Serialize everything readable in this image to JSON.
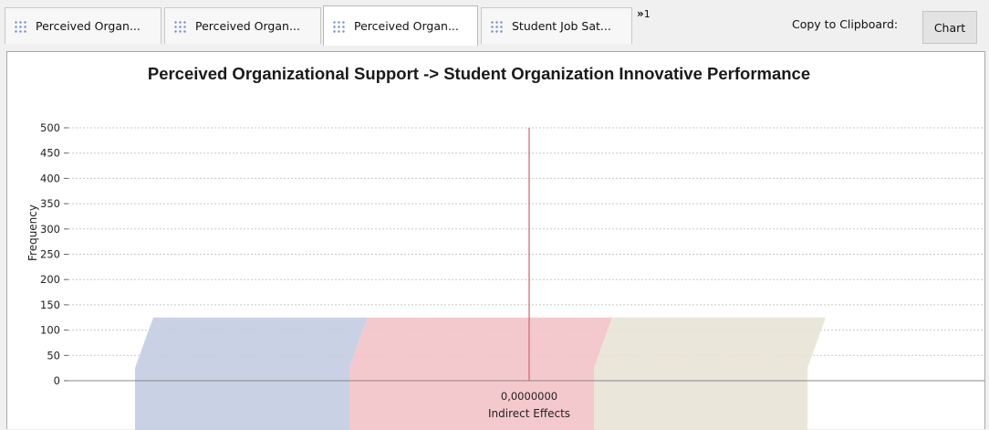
{
  "tabs": [
    {
      "label": "Perceived Organ...",
      "active": false
    },
    {
      "label": "Perceived Organ...",
      "active": false
    },
    {
      "label": "Perceived Organ...",
      "active": true
    },
    {
      "label": "Student Job Sat...",
      "active": false
    }
  ],
  "tab_overflow": {
    "glyph": "»",
    "count": "1"
  },
  "toolbar": {
    "copy_label": "Copy to Clipboard:",
    "chart_button": "Chart"
  },
  "chart_data": {
    "type": "bar",
    "title": "Perceived Organizational Support -> Student Organization Innovative Performance",
    "xlabel": "Indirect Effects",
    "ylabel": "Frequency",
    "ylim": [
      0,
      500
    ],
    "y_ticks": [
      0,
      50,
      100,
      150,
      200,
      250,
      300,
      350,
      400,
      450,
      500
    ],
    "x_tick_labels": [
      "0,0000000"
    ],
    "grid": true,
    "bars": [
      {
        "value": 125,
        "color": "#c2cce0"
      },
      {
        "value": 125,
        "color": "#f2c2c6"
      },
      {
        "value": 125,
        "color": "#e8e2d5"
      }
    ],
    "reference_line": {
      "x": 0,
      "y_top": 500,
      "color": "#d06070"
    }
  }
}
